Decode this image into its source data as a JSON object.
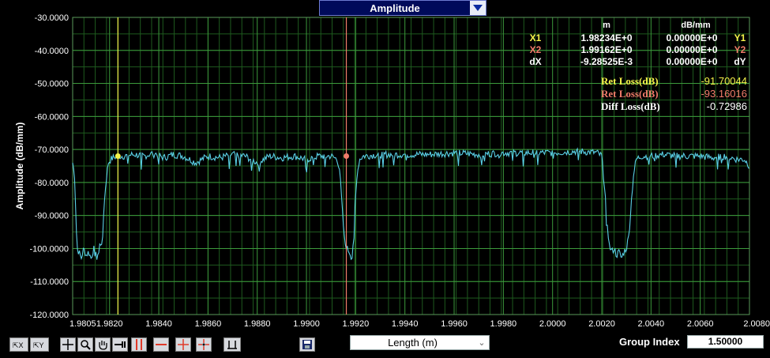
{
  "display_select": {
    "value": "Amplitude"
  },
  "x_select": {
    "value": "Length (m)"
  },
  "group_index": {
    "label": "Group Index",
    "value": "1.50000"
  },
  "cursor_table": {
    "col_m": "m",
    "col_db": "dB/mm",
    "rows": [
      {
        "left": "X1",
        "m": "1.98234E+0",
        "db": "0.00000E+0",
        "right": "Y1",
        "color": "#f4f24a"
      },
      {
        "left": "X2",
        "m": "1.99162E+0",
        "db": "0.00000E+0",
        "right": "Y2",
        "color": "#f07c6a"
      },
      {
        "left": "dX",
        "m": "-9.28525E-3",
        "db": "0.00000E+0",
        "right": "dY",
        "color": "#ffffff"
      }
    ]
  },
  "loss_readouts": [
    {
      "label": "Ret Loss(dB)",
      "value": "-91.70044",
      "color": "#f4f24a"
    },
    {
      "label": "Ret Loss(dB)",
      "value": "-93.16016",
      "color": "#f07c6a"
    },
    {
      "label": "Diff Loss(dB)",
      "value": "-0.72986",
      "color": "#ffffff"
    }
  ],
  "toolbar_icons": [
    "zoom-x-icon",
    "zoom-y-icon",
    "crosshair-icon",
    "zoom-icon",
    "pan-hand-icon",
    "cursor-icon",
    "vertical-cursor-icon",
    "horizontal-cursor-icon",
    "cross-cursor-icon",
    "center-cursor-icon",
    "clear-cursor-icon",
    "save-icon"
  ],
  "chart_data": {
    "type": "line",
    "title": "",
    "xlabel": "",
    "ylabel": "Amplitude (dB/mm)",
    "xlim": [
      1.9805,
      2.008
    ],
    "ylim": [
      -120,
      -30
    ],
    "x_ticks": [
      "1.9805",
      "1.9820",
      "1.9840",
      "1.9860",
      "1.9880",
      "1.9900",
      "1.9920",
      "1.9940",
      "1.9960",
      "1.9980",
      "2.0000",
      "2.0020",
      "2.0040",
      "2.0060",
      "2.0080"
    ],
    "y_ticks": [
      "-30.0000",
      "-40.0000",
      "-50.0000",
      "-60.0000",
      "-70.0000",
      "-80.0000",
      "-90.0000",
      "-100.0000",
      "-110.0000",
      "-120.0000"
    ],
    "grid": true,
    "trace_color": "#5ad0e6",
    "baseline_db": -72,
    "trace": [
      [
        1.9805,
        -74
      ],
      [
        1.98058,
        -78
      ],
      [
        1.98064,
        -92
      ],
      [
        1.98068,
        -100
      ],
      [
        1.98075,
        -101
      ],
      [
        1.98085,
        -103
      ],
      [
        1.98095,
        -100
      ],
      [
        1.98105,
        -102
      ],
      [
        1.98115,
        -101
      ],
      [
        1.98125,
        -103
      ],
      [
        1.98135,
        -100
      ],
      [
        1.98145,
        -101
      ],
      [
        1.98155,
        -102
      ],
      [
        1.9816,
        -99
      ],
      [
        1.98168,
        -98
      ],
      [
        1.98175,
        -90
      ],
      [
        1.98185,
        -80
      ],
      [
        1.98195,
        -74
      ],
      [
        1.98205,
        -73
      ],
      [
        1.98215,
        -72.5
      ],
      [
        1.9823,
        -72
      ],
      [
        1.9826,
        -72
      ],
      [
        1.983,
        -71.5
      ],
      [
        1.9834,
        -72
      ],
      [
        1.9838,
        -71
      ],
      [
        1.9842,
        -72.5
      ],
      [
        1.9846,
        -71.5
      ],
      [
        1.985,
        -72
      ],
      [
        1.9855,
        -74
      ],
      [
        1.986,
        -72
      ],
      [
        1.9865,
        -72.5
      ],
      [
        1.987,
        -71.5
      ],
      [
        1.9875,
        -72
      ],
      [
        1.988,
        -74
      ],
      [
        1.9885,
        -72
      ],
      [
        1.989,
        -72.5
      ],
      [
        1.9895,
        -72
      ],
      [
        1.99,
        -73
      ],
      [
        1.9905,
        -72
      ],
      [
        1.991,
        -72
      ],
      [
        1.99125,
        -73
      ],
      [
        1.99135,
        -76
      ],
      [
        1.99145,
        -88
      ],
      [
        1.99155,
        -98
      ],
      [
        1.99165,
        -100
      ],
      [
        1.99175,
        -101
      ],
      [
        1.99185,
        -103
      ],
      [
        1.9919,
        -98
      ],
      [
        1.99195,
        -90
      ],
      [
        1.99205,
        -78
      ],
      [
        1.99215,
        -73
      ],
      [
        1.9923,
        -72
      ],
      [
        1.993,
        -71.5
      ],
      [
        1.994,
        -71.5
      ],
      [
        1.995,
        -71.5
      ],
      [
        1.996,
        -71
      ],
      [
        1.997,
        -71.5
      ],
      [
        1.998,
        -71
      ],
      [
        1.999,
        -71
      ],
      [
        2.0,
        -71
      ],
      [
        2.001,
        -70.5
      ],
      [
        2.0018,
        -71
      ],
      [
        2.002,
        -72
      ],
      [
        2.0021,
        -80
      ],
      [
        2.00222,
        -92
      ],
      [
        2.0023,
        -99
      ],
      [
        2.0024,
        -101
      ],
      [
        2.0025,
        -100
      ],
      [
        2.0026,
        -102
      ],
      [
        2.0027,
        -101
      ],
      [
        2.0028,
        -103
      ],
      [
        2.0029,
        -101
      ],
      [
        2.003,
        -100
      ],
      [
        2.0031,
        -96
      ],
      [
        2.00318,
        -88
      ],
      [
        2.00328,
        -78
      ],
      [
        2.0034,
        -73
      ],
      [
        2.0036,
        -72
      ],
      [
        2.004,
        -72
      ],
      [
        2.0045,
        -71.5
      ],
      [
        2.005,
        -72
      ],
      [
        2.0055,
        -72
      ],
      [
        2.006,
        -72
      ],
      [
        2.0065,
        -72.5
      ],
      [
        2.007,
        -72
      ],
      [
        2.0075,
        -73
      ],
      [
        2.0078,
        -73
      ],
      [
        2.008,
        -75
      ]
    ],
    "cursors": [
      {
        "name": "X1",
        "x": 1.98234,
        "y": -72,
        "color": "#f4f24a"
      },
      {
        "name": "X2",
        "x": 1.99162,
        "y": -72,
        "color": "#f07c6a"
      }
    ]
  }
}
